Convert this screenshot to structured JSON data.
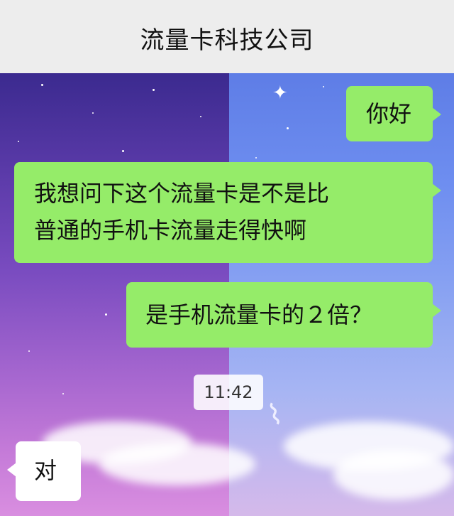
{
  "header": {
    "title": "流量卡科技公司"
  },
  "messages": [
    {
      "side": "right",
      "text": "你好"
    },
    {
      "side": "right",
      "lines": [
        "我想问下这个流量卡是不是比",
        "普通的手机卡流量走得快啊"
      ]
    },
    {
      "side": "right",
      "text": "是手机流量卡的２倍？"
    },
    {
      "side": "left",
      "text": "对"
    }
  ],
  "timestamp": "11:42",
  "colors": {
    "header_bg": "#ededed",
    "outgoing_bubble": "#95ec69",
    "incoming_bubble": "#ffffff",
    "bg_left": "#5a3aa8",
    "bg_right": "#6e8ef0"
  }
}
